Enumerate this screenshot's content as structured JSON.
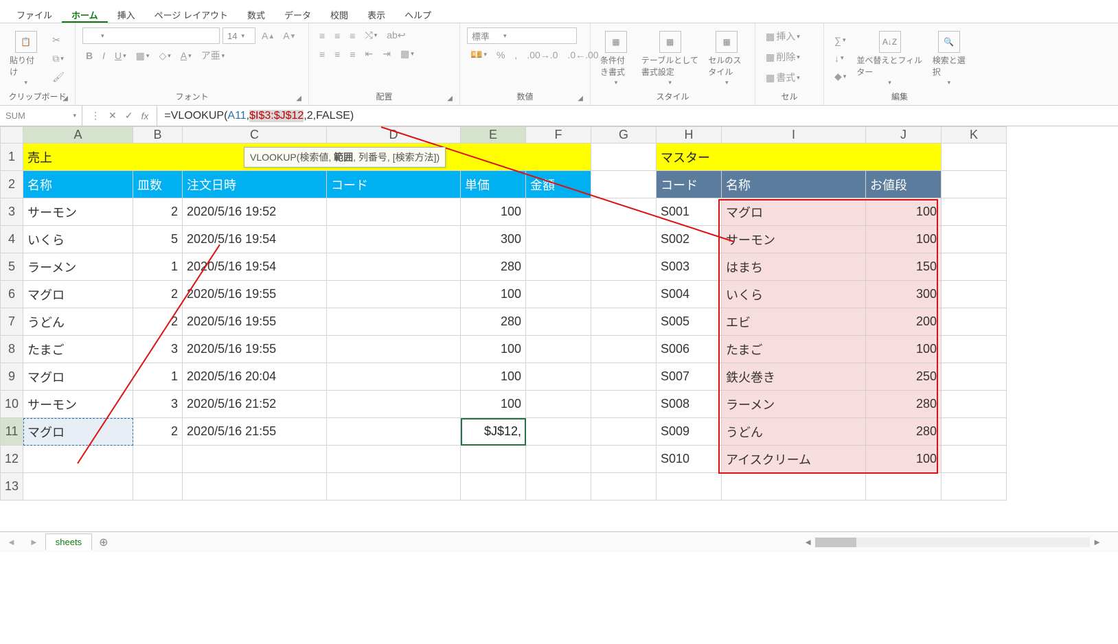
{
  "tabs": {
    "file": "ファイル",
    "home": "ホーム",
    "insert": "挿入",
    "layout": "ページ レイアウト",
    "formulas": "数式",
    "data": "データ",
    "review": "校閲",
    "view": "表示",
    "help": "ヘルプ"
  },
  "groups": {
    "clipboard": "クリップボード",
    "font": "フォント",
    "align": "配置",
    "num": "数値",
    "styles": "スタイル",
    "cells": "セル",
    "editing": "編集"
  },
  "ribbon": {
    "paste": "貼り付け",
    "fontsize": "14",
    "numberformat": "標準",
    "cond": "条件付き書式",
    "tablefmt": "テーブルとして書式設定",
    "cellstyle": "セルのスタイル",
    "ins": "挿入",
    "del": "削除",
    "fmt": "書式",
    "sort": "並べ替えとフィルター",
    "find": "検索と選択"
  },
  "formula": {
    "namebox": "SUM",
    "pre": "=VLOOKUP(",
    "a11": "A11",
    "range": "$I$3:$J$12",
    "post": ",2,FALSE)",
    "hint_pre": "VLOOKUP(検索値, ",
    "hint_bold": "範囲",
    "hint_post": ", 列番号, [検索方法])"
  },
  "cols": [
    "A",
    "B",
    "C",
    "D",
    "E",
    "F",
    "G",
    "H",
    "I",
    "J",
    "K"
  ],
  "sales": {
    "title": "売上",
    "h": {
      "name": "名称",
      "qty": "皿数",
      "time": "注文日時",
      "code": "コード",
      "price": "単価",
      "amt": "金額"
    },
    "rows": [
      {
        "name": "サーモン",
        "qty": 2,
        "time": "2020/5/16 19:52",
        "price": 100
      },
      {
        "name": "いくら",
        "qty": 5,
        "time": "2020/5/16 19:54",
        "price": 300
      },
      {
        "name": "ラーメン",
        "qty": 1,
        "time": "2020/5/16 19:54",
        "price": 280
      },
      {
        "name": "マグロ",
        "qty": 2,
        "time": "2020/5/16 19:55",
        "price": 100
      },
      {
        "name": "うどん",
        "qty": 2,
        "time": "2020/5/16 19:55",
        "price": 280
      },
      {
        "name": "たまご",
        "qty": 3,
        "time": "2020/5/16 19:55",
        "price": 100
      },
      {
        "name": "マグロ",
        "qty": 1,
        "time": "2020/5/16 20:04",
        "price": 100
      },
      {
        "name": "サーモン",
        "qty": 3,
        "time": "2020/5/16 21:52",
        "price": 100
      },
      {
        "name": "マグロ",
        "qty": 2,
        "time": "2020/5/16 21:55",
        "edit": "$J$12,"
      }
    ]
  },
  "master": {
    "title": "マスター",
    "h": {
      "code": "コード",
      "name": "名称",
      "price": "お値段"
    },
    "rows": [
      {
        "code": "S001",
        "name": "マグロ",
        "price": 100
      },
      {
        "code": "S002",
        "name": "サーモン",
        "price": 100
      },
      {
        "code": "S003",
        "name": "はまち",
        "price": 150
      },
      {
        "code": "S004",
        "name": "いくら",
        "price": 300
      },
      {
        "code": "S005",
        "name": "エビ",
        "price": 200
      },
      {
        "code": "S006",
        "name": "たまご",
        "price": 100
      },
      {
        "code": "S007",
        "name": "鉄火巻き",
        "price": 250
      },
      {
        "code": "S008",
        "name": "ラーメン",
        "price": 280
      },
      {
        "code": "S009",
        "name": "うどん",
        "price": 280
      },
      {
        "code": "S010",
        "name": "アイスクリーム",
        "price": 100
      }
    ]
  },
  "sheet_tab": "sheets"
}
